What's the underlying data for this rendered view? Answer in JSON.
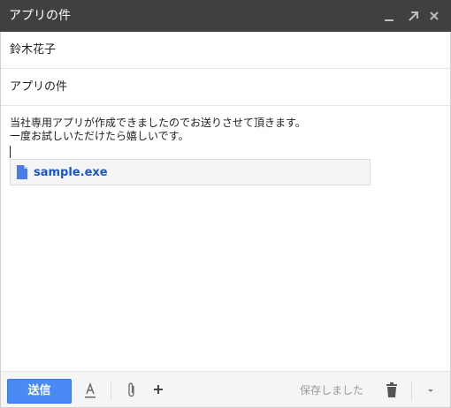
{
  "window": {
    "title": "アプリの件",
    "icons": [
      "minimize-icon",
      "expand-icon",
      "close-icon"
    ]
  },
  "to": {
    "value": "鈴木花子"
  },
  "subject": {
    "value": "アプリの件"
  },
  "body": {
    "lines": [
      "当社専用アプリが作成できましたのでお送りさせて頂きます。",
      "一度お試しいただけたら嬉しいです。"
    ]
  },
  "attachment": {
    "filename": "sample.exe",
    "icon": "file-icon"
  },
  "footer": {
    "send_label": "送信",
    "saved_status": "保存しました",
    "icons": [
      "format-text-icon",
      "paperclip-icon",
      "plus-icon",
      "trash-icon",
      "chevron-down-icon"
    ]
  },
  "colors": {
    "titlebar": "#404040",
    "send_button": "#4a8af4",
    "attachment_name": "#1a56c8"
  }
}
